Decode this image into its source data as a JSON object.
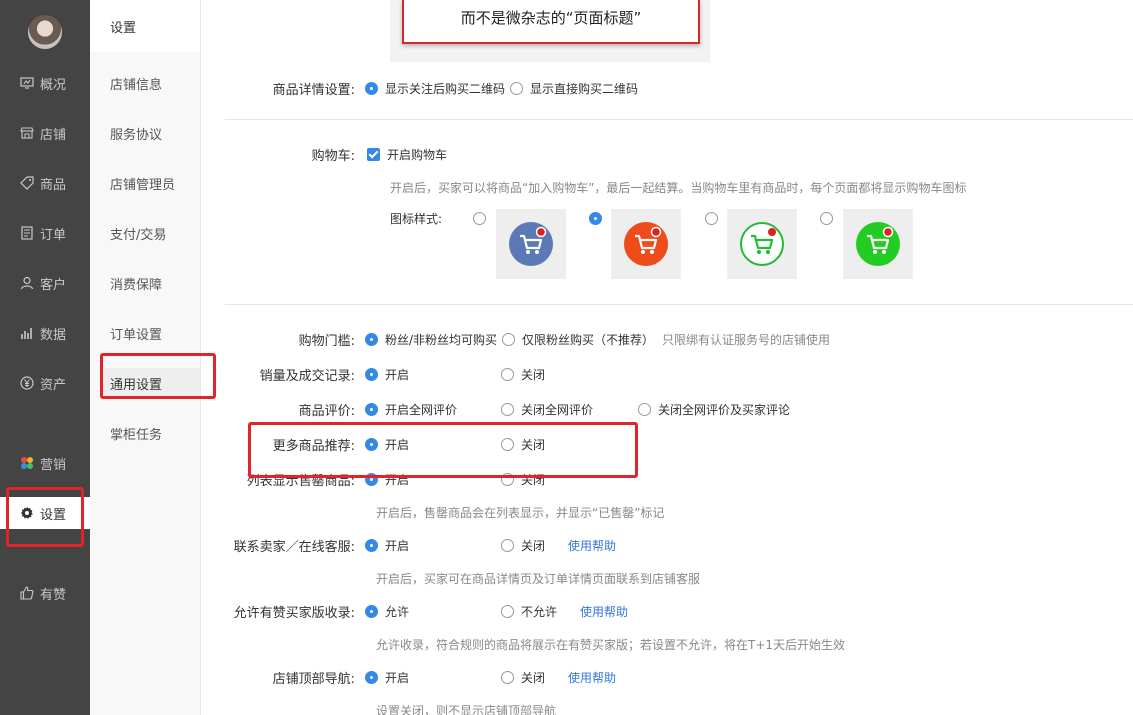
{
  "sidebar": {
    "items": [
      {
        "label": "概况",
        "icon": "overview-icon"
      },
      {
        "label": "店铺",
        "icon": "store-icon"
      },
      {
        "label": "商品",
        "icon": "tag-icon"
      },
      {
        "label": "订单",
        "icon": "order-icon"
      },
      {
        "label": "客户",
        "icon": "customer-icon"
      },
      {
        "label": "数据",
        "icon": "chart-icon"
      },
      {
        "label": "资产",
        "icon": "yuan-icon"
      },
      {
        "label": "营销",
        "icon": "marketing-icon"
      },
      {
        "label": "设置",
        "icon": "gear-icon"
      },
      {
        "label": "有赞",
        "icon": "thumbs-up-icon"
      }
    ]
  },
  "subnav": {
    "title": "设置",
    "items": [
      "店铺信息",
      "服务协议",
      "店铺管理员",
      "支付/交易",
      "消费保障",
      "订单设置",
      "通用设置",
      "掌柜任务"
    ]
  },
  "callout": {
    "text": "而不是微杂志的“页面标题”"
  },
  "product_detail": {
    "label": "商品详情设置:",
    "options": [
      "显示关注后购买二维码",
      "显示直接购买二维码"
    ]
  },
  "cart": {
    "label": "购物车:",
    "checkbox_label": "开启购物车",
    "hint": "开启后，买家可以将商品“加入购物车”，最后一起结算。当购物车里有商品时，每个页面都将显示购物车图标",
    "icon_style_label": "图标样式:",
    "styles": [
      {
        "bg": "#5b79b4",
        "dot": "#e02020"
      },
      {
        "bg": "#ee4c1a",
        "dot": "#e02020"
      },
      {
        "bg": "#ffffff",
        "dot": "#e02020",
        "ring": "#22bb33"
      },
      {
        "bg": "#22cc22",
        "dot": "#e02020"
      }
    ]
  },
  "threshold": {
    "label": "购物门槛:",
    "options": [
      "粉丝/非粉丝均可购买",
      "仅限粉丝购买（不推荐）"
    ],
    "note": "只限绑有认证服务号的店铺使用"
  },
  "sales_record": {
    "label": "销量及成交记录:",
    "options": [
      "开启",
      "关闭"
    ]
  },
  "review": {
    "label": "商品评价:",
    "options": [
      "开启全网评价",
      "关闭全网评价",
      "关闭全网评价及买家评论"
    ]
  },
  "recommend": {
    "label": "更多商品推荐:",
    "options": [
      "开启",
      "关闭"
    ]
  },
  "soldout": {
    "label": "列表显示售罄商品:",
    "options": [
      "开启",
      "关闭"
    ],
    "hint": "开启后，售罄商品会在列表显示，并显示“已售罄”标记"
  },
  "contact": {
    "label": "联系卖家／在线客服:",
    "options": [
      "开启",
      "关闭"
    ],
    "help": "使用帮助",
    "hint": "开启后，买家可在商品详情页及订单详情页面联系到店铺客服"
  },
  "youzan": {
    "label": "允许有赞买家版收录:",
    "options": [
      "允许",
      "不允许"
    ],
    "help": "使用帮助",
    "hint": "允许收录，符合规则的商品将展示在有赞买家版；若设置不允许，将在T+1天后开始生效"
  },
  "topnav": {
    "label": "店铺顶部导航:",
    "options": [
      "开启",
      "关闭"
    ],
    "help": "使用帮助",
    "hint": "设置关闭，则不显示店铺顶部导航"
  }
}
